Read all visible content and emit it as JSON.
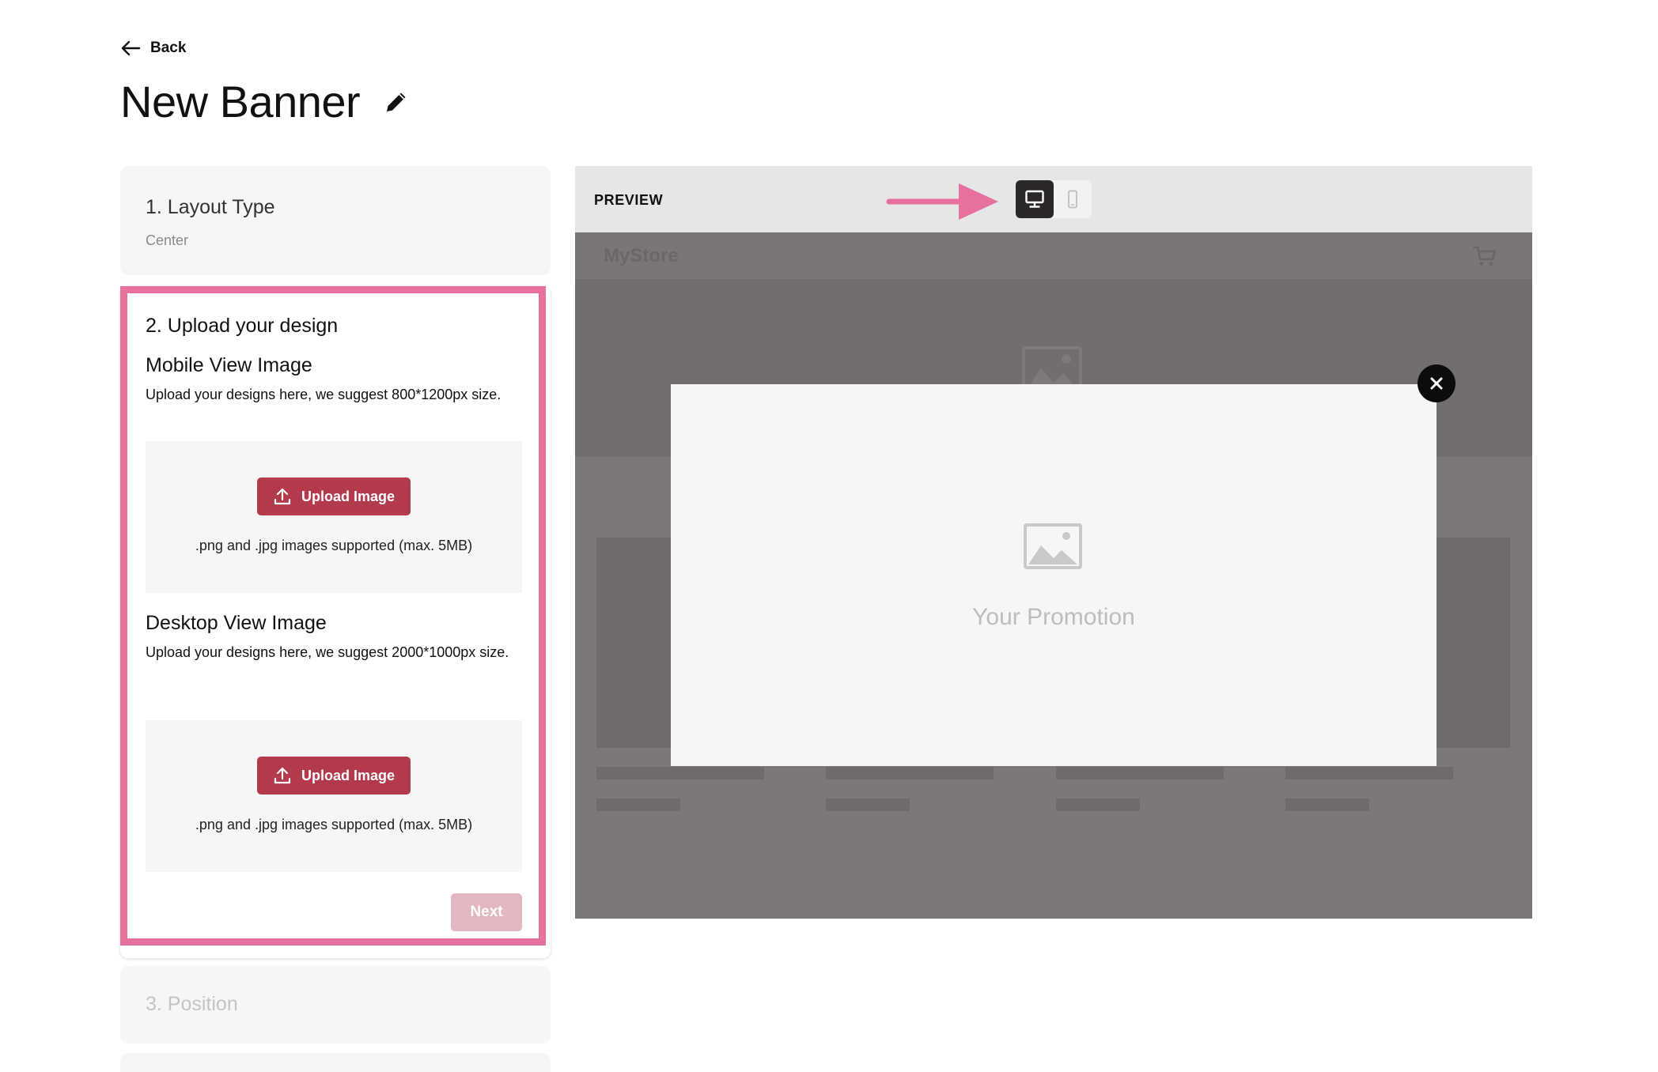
{
  "header": {
    "back_label": "Back",
    "title": "New Banner"
  },
  "steps": {
    "layout": {
      "title": "1. Layout Type",
      "value": "Center"
    },
    "upload": {
      "title": "2. Upload your design",
      "mobile": {
        "title": "Mobile View Image",
        "description": "Upload your designs here, we suggest 800*1200px size.",
        "button_label": "Upload Image",
        "support_text": ".png and .jpg images supported (max. 5MB)"
      },
      "desktop": {
        "title": "Desktop View Image",
        "description": "Upload your designs here, we suggest 2000*1000px size.",
        "button_label": "Upload Image",
        "support_text": ".png and .jpg images supported (max. 5MB)"
      },
      "next_label": "Next"
    },
    "position": {
      "title": "3. Position"
    }
  },
  "preview": {
    "label": "PREVIEW",
    "devices": [
      {
        "name": "desktop",
        "icon": "desktop-icon",
        "active": true
      },
      {
        "name": "mobile",
        "icon": "mobile-icon",
        "active": false
      }
    ],
    "store_name": "MyStore",
    "promo_text": "Your Promotion"
  },
  "colors": {
    "accent": "#b3394c",
    "highlight": "#e8709f",
    "next_disabled": "#e2b7bf",
    "preview_overlay": "#7c7878"
  }
}
